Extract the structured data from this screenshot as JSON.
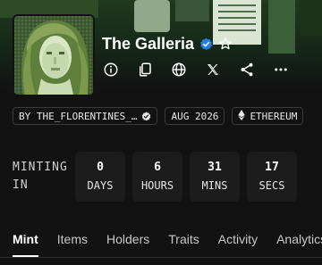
{
  "collection": {
    "title": "The Galleria",
    "verified": true,
    "favorite_icon": "star-outline-icon"
  },
  "actions": [
    {
      "name": "info-icon"
    },
    {
      "name": "copy-icon"
    },
    {
      "name": "globe-icon"
    },
    {
      "name": "x-logo-icon"
    },
    {
      "name": "share-icon"
    },
    {
      "name": "more-icon"
    }
  ],
  "chips": {
    "creator": "BY THE_FLORENTINES_…",
    "date": "AUG 2026",
    "chain": "ETHEREUM"
  },
  "minting": {
    "label": "MINTING IN",
    "countdown": [
      {
        "value": "0",
        "unit": "DAYS"
      },
      {
        "value": "6",
        "unit": "HOURS"
      },
      {
        "value": "31",
        "unit": "MINS"
      },
      {
        "value": "17",
        "unit": "SECS"
      }
    ]
  },
  "tabs": [
    "Mint",
    "Items",
    "Holders",
    "Traits",
    "Activity",
    "Analytics"
  ],
  "colors": {
    "background": "#121212",
    "verified_blue": "#2081e2",
    "banner_green": "#1f3a1c"
  }
}
